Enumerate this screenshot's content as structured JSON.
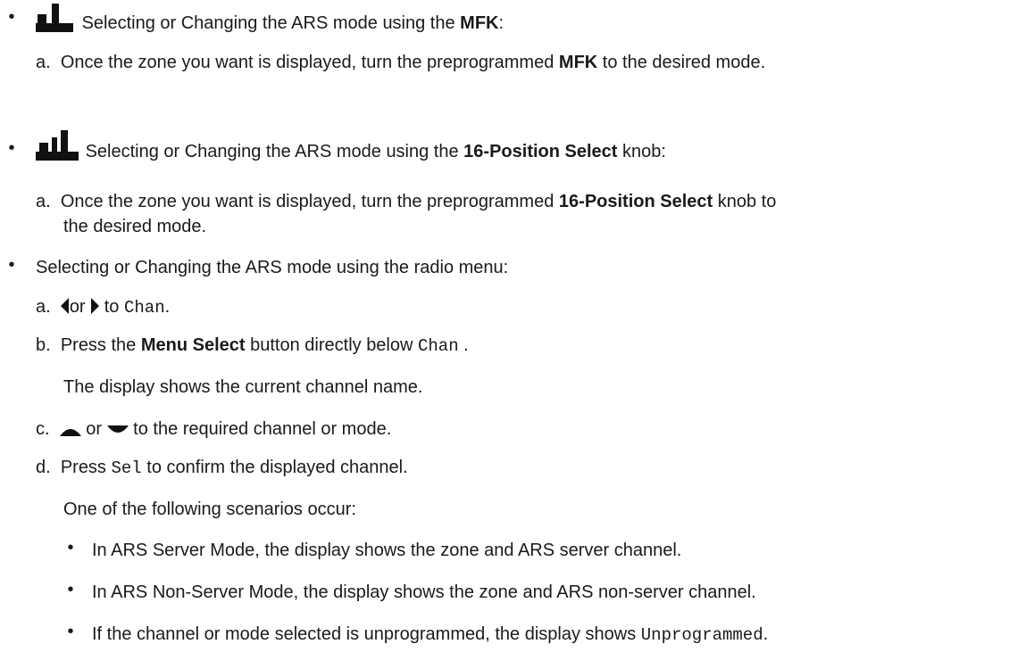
{
  "items": [
    {
      "bullet": "•",
      "intro_pre": "Selecting or Changing the ARS mode using the ",
      "intro_bold": "MFK",
      "intro_post": ":",
      "step_a": {
        "letter": "a.",
        "pre": "Once the zone you want is displayed, turn the preprogrammed ",
        "bold": "MFK",
        "post": " to the desired mode."
      }
    },
    {
      "bullet": "•",
      "intro_pre": "Selecting or Changing the ARS mode using the ",
      "intro_bold": "16-Position Select",
      "intro_post": " knob:",
      "step_a": {
        "letter": "a.",
        "pre": "Once the zone you want is displayed, turn the preprogrammed ",
        "bold": "16-Position Select",
        "post": " knob to",
        "cont": "the desired mode."
      }
    },
    {
      "bullet": "•",
      "intro": "Selecting or Changing the ARS mode using the radio menu:",
      "step_a": {
        "letter": "a.",
        "or": "or",
        "to": "to",
        "mono": "Chan",
        "end": "."
      },
      "step_b": {
        "letter": "b.",
        "pre": "Press the ",
        "bold": "Menu Select",
        "mid": " button directly below ",
        "mono": "Chan",
        "end": " .",
        "result": "The display shows the current channel name."
      },
      "step_c": {
        "letter": "c.",
        "or": "or",
        "post": "to the required channel or mode."
      },
      "step_d": {
        "letter": "d.",
        "pre": "Press ",
        "mono": "Sel",
        "post": " to confirm the displayed channel.",
        "result": "One of the following scenarios occur:",
        "scenarios": [
          {
            "text": "In ARS Server Mode, the display shows the zone and ARS server channel."
          },
          {
            "text": "In ARS Non-Server Mode, the display shows the zone and ARS non-server channel."
          },
          {
            "pre": "If the channel or mode selected is unprogrammed, the display shows ",
            "mono": "Unprogrammed",
            "end": "."
          }
        ]
      }
    }
  ]
}
